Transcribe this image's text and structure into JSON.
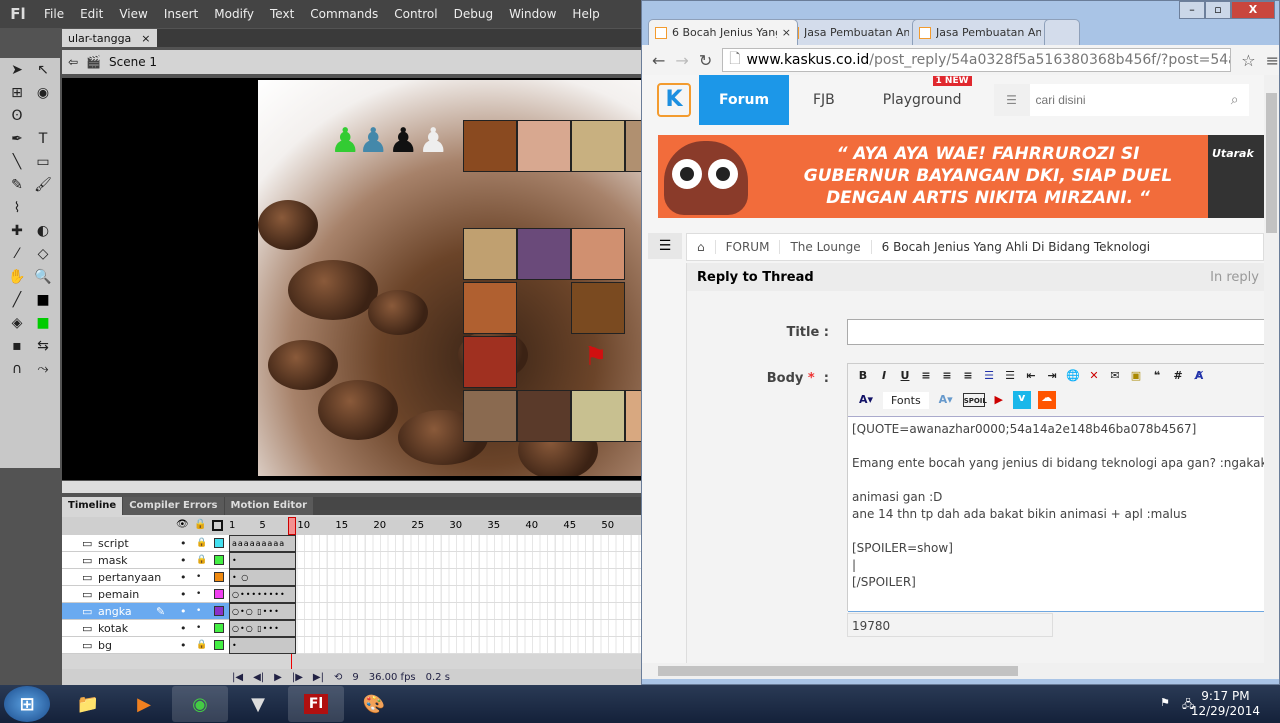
{
  "flash": {
    "logo": "Fl",
    "menu": [
      "File",
      "Edit",
      "View",
      "Insert",
      "Modify",
      "Text",
      "Commands",
      "Control",
      "Debug",
      "Window",
      "Help"
    ],
    "doc_tab": "ular-tangga",
    "doc_close": "×",
    "scene": "Scene 1",
    "tools": [
      "➤",
      "↖",
      "⊞",
      "◉",
      "ʘ",
      "",
      "✒",
      "T",
      "╲",
      "▭",
      "✎",
      "🖌",
      "⌇",
      "",
      "✚",
      "◐",
      "⁄",
      "◇",
      "✋",
      "🔍",
      "╱",
      "■",
      "◈",
      "■",
      "▪",
      "⇆",
      "∩",
      "⤳"
    ],
    "stroke_color": "#000000",
    "fill_color": "#00cc00",
    "timeline_tabs": [
      "Timeline",
      "Compiler Errors",
      "Motion Editor"
    ],
    "frame_numbers": [
      "1",
      "5",
      "10",
      "15",
      "20",
      "25",
      "30",
      "35",
      "40",
      "45",
      "50"
    ],
    "current_frame": "9",
    "fps": "36.00",
    "fps_unit": "fps",
    "elapsed": "0.2 s",
    "layers": [
      {
        "name": "script",
        "color": "#44e0f0",
        "locked": true,
        "frames": "aaaaaaaaa"
      },
      {
        "name": "mask",
        "color": "#44ee44",
        "locked": true,
        "frames": "•"
      },
      {
        "name": "pertanyaan",
        "color": "#f08a10",
        "locked": false,
        "frames": "• ○"
      },
      {
        "name": "pemain",
        "color": "#f040f0",
        "locked": false,
        "frames": "○••••••••"
      },
      {
        "name": "angka",
        "color": "#8a30c8",
        "locked": false,
        "selected": true,
        "frames": "○•○   ▯•••"
      },
      {
        "name": "kotak",
        "color": "#44ee44",
        "locked": false,
        "frames": "○•○   ▯•••"
      },
      {
        "name": "bg",
        "color": "#44ee44",
        "locked": true,
        "frames": "•"
      }
    ]
  },
  "chrome": {
    "tabs": [
      {
        "title": "6 Bocah Jenius Yang A",
        "active": true
      },
      {
        "title": "Jasa Pembuatan Anim"
      },
      {
        "title": "Jasa Pembuatan Anim"
      }
    ],
    "tab_close": "×",
    "url_domain": "www.kaskus.co.id",
    "url_path": "/post_reply/54a0328f5a516380368b456f/?post=54a",
    "kaskus": {
      "logo": "K",
      "nav": [
        "Forum",
        "FJB",
        "Playground"
      ],
      "new_badge": "1 NEW",
      "search_placeholder": "cari disini",
      "banner_text": "“ AYA AYA WAE! FAHRRUROZI SI GUBERNUR BAYANGAN DKI, SIAP DUEL DENGAN ARTIS NIKITA MIRZANI. “",
      "banner_side": "Utarak",
      "breadcrumb": [
        "FORUM",
        "The Lounge",
        "6 Bocah Jenius Yang Ahli Di Bidang Teknologi"
      ],
      "form_title": "Reply to Thread",
      "in_reply": "In reply",
      "title_label": "Title  :",
      "body_label": "Body",
      "required": "*",
      "colon": ":",
      "title_value": "",
      "fonts_label": "Fonts",
      "body_text": "[QUOTE=awanazhar0000;54a14a2e148b46ba078b4567]\n\nEmang ente bocah yang jenius di bidang teknologi apa gan? :ngakak[/QUOTE]\n\nanimasi gan :D\nane 14 thn tp dah ada bakat bikin animasi + apl :malus\n\n[SPOILER=show]\n|\n[/SPOILER]",
      "char_count": "19780"
    }
  },
  "taskbar": {
    "apps": [
      "windows-explorer",
      "media-player",
      "chrome",
      "app",
      "flash",
      "paint"
    ],
    "time": "9:17 PM",
    "date": "12/29/2014"
  }
}
